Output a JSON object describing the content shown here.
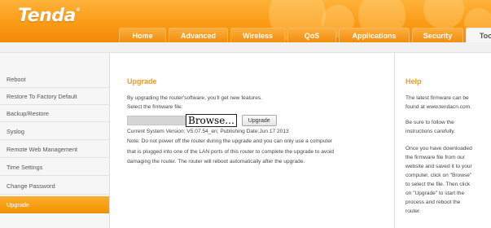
{
  "brand": {
    "logo_text": "Tenda",
    "trademark": "®",
    "accent_color": "#f39a1e",
    "header_color": "#fb9b16"
  },
  "nav": {
    "tabs": [
      {
        "label": "Home"
      },
      {
        "label": "Advanced"
      },
      {
        "label": "Wireless"
      },
      {
        "label": "QoS"
      },
      {
        "label": "Applications"
      },
      {
        "label": "Security"
      },
      {
        "label": "Tools",
        "active": true
      }
    ]
  },
  "sidebar": {
    "items": [
      {
        "label": "Reboot"
      },
      {
        "label": "Restore To Factory Default"
      },
      {
        "label": "Backup/Restore"
      },
      {
        "label": "Syslog"
      },
      {
        "label": "Remote Web Management"
      },
      {
        "label": "Time Settings"
      },
      {
        "label": "Change Password"
      },
      {
        "label": "Upgrade",
        "active": true
      }
    ]
  },
  "main": {
    "title": "Upgrade",
    "intro": "By upgrading the router'software, you'll get new features.",
    "select_label": "Select the firmware file:",
    "file_value": "",
    "browse_label": "Browse...",
    "upgrade_label": "Upgrade",
    "version_line": "Current System Version: V5.07.54_en; Publishing Date:Jun 17 2013",
    "note_lines": [
      "Note: Do not power off the router during the upgrade and you can only use a computer",
      "that is plugged into one of the LAN ports of this router to complete the upgrade to avoid",
      "damaging the router. The router will reboot automatically after the upgrade."
    ]
  },
  "help": {
    "title": "Help",
    "para1_lines": [
      "The latest firmware can be",
      "found at www.tendacn.com."
    ],
    "para2_lines": [
      "Be sure to follow the",
      "instructions carefully."
    ],
    "para3_lines": [
      "Once you have downloaded",
      "the firmware file from our",
      "website and saved it to your",
      "computer, click on \"Browse\"",
      "to select the file. Then click",
      "on \"Upgrade\" to start the",
      "process and reboot the",
      "router."
    ]
  }
}
